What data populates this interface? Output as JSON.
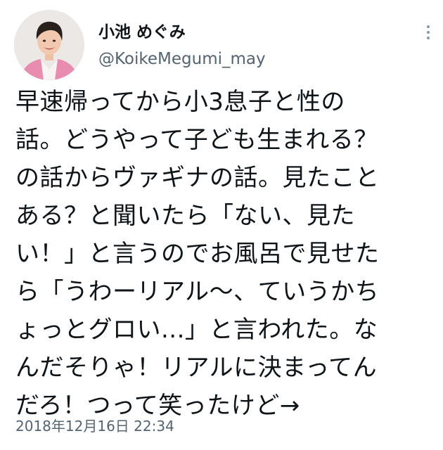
{
  "user": {
    "display_name": "小池 めぐみ",
    "handle": "@KoikeMegumi_may"
  },
  "tweet": {
    "lines": [
      "早速帰ってから小3息子と性の",
      "話。どうやって子ども生まれる？",
      "の話からヴァギナの話。見たこと",
      "ある？と聞いたら「ない、見た",
      "い！」と言うのでお風呂で見せた",
      "ら「うわーリアル〜、ていうかち",
      "ょっとグロい...」と言われた。な",
      "んだそりゃ！リアルに決まってん",
      "だろ！つって笑ったけど→"
    ],
    "timestamp": "2018年12月16日 22:34"
  },
  "icons": {
    "more": "more-vertical-icon",
    "avatar": "profile-photo"
  },
  "colors": {
    "text_primary": "#0f1419",
    "text_secondary": "#536471",
    "jacket": "#e78fb0"
  }
}
